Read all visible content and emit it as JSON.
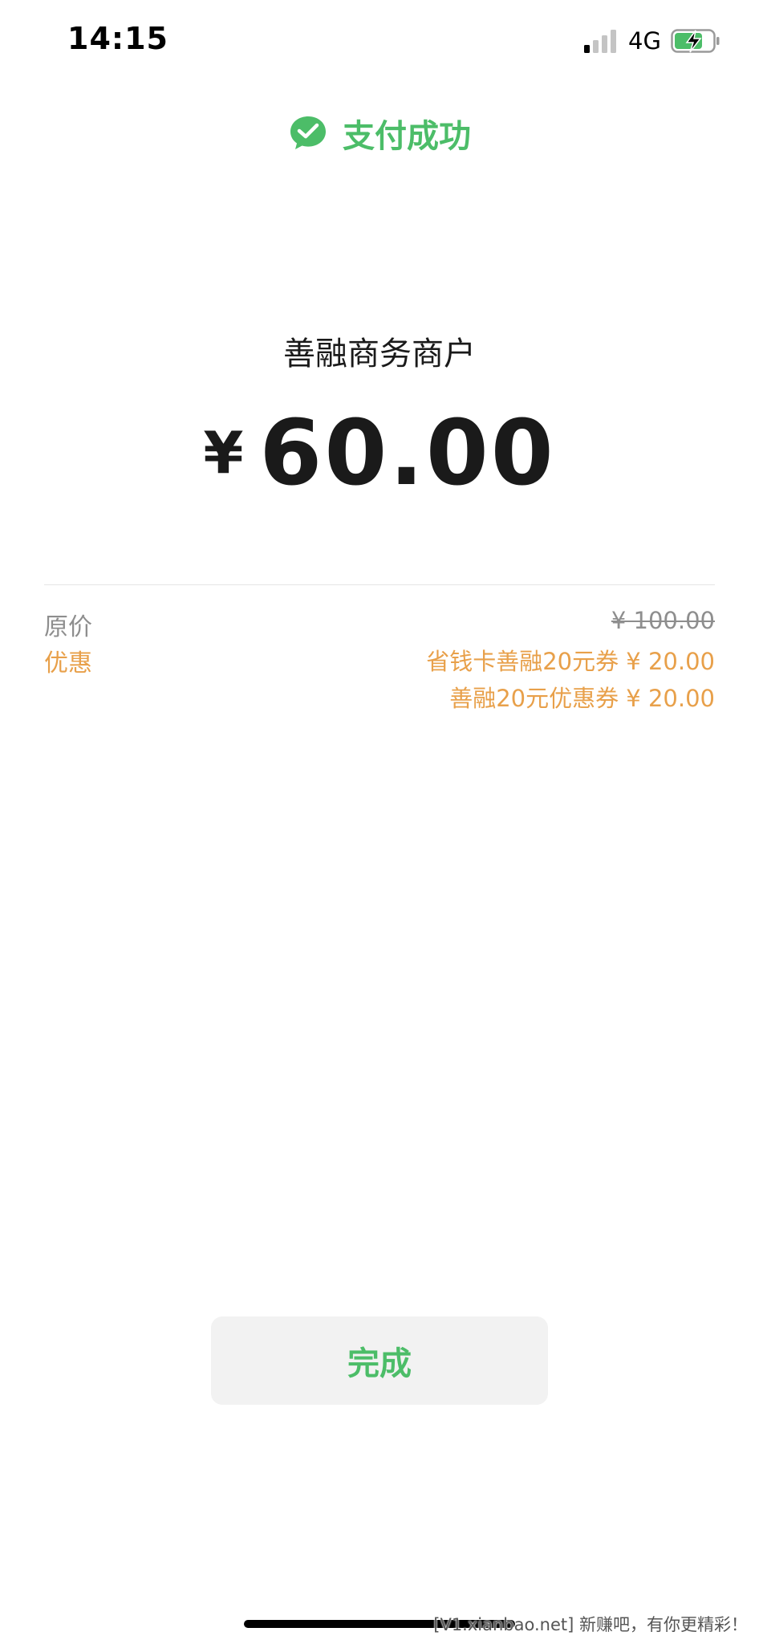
{
  "status_bar": {
    "time": "14:15",
    "network": "4G",
    "icons": [
      "signal-icon",
      "battery-charging-icon"
    ]
  },
  "header": {
    "title": "支付成功",
    "icon": "wechat-pay-icon",
    "accent_color": "#4cbd68"
  },
  "payment": {
    "merchant": "善融商务商户",
    "currency_symbol": "¥",
    "amount": "60.00"
  },
  "details": {
    "original_label": "原价",
    "original_value": "¥ 100.00",
    "discount_label": "优惠",
    "discounts": [
      "省钱卡善融20元券 ¥ 20.00",
      "善融20元优惠券 ¥ 20.00"
    ],
    "discount_color": "#e8a04a"
  },
  "actions": {
    "done_label": "完成"
  },
  "watermark": "[V1.xianbao.net] 新赚吧，有你更精彩！"
}
